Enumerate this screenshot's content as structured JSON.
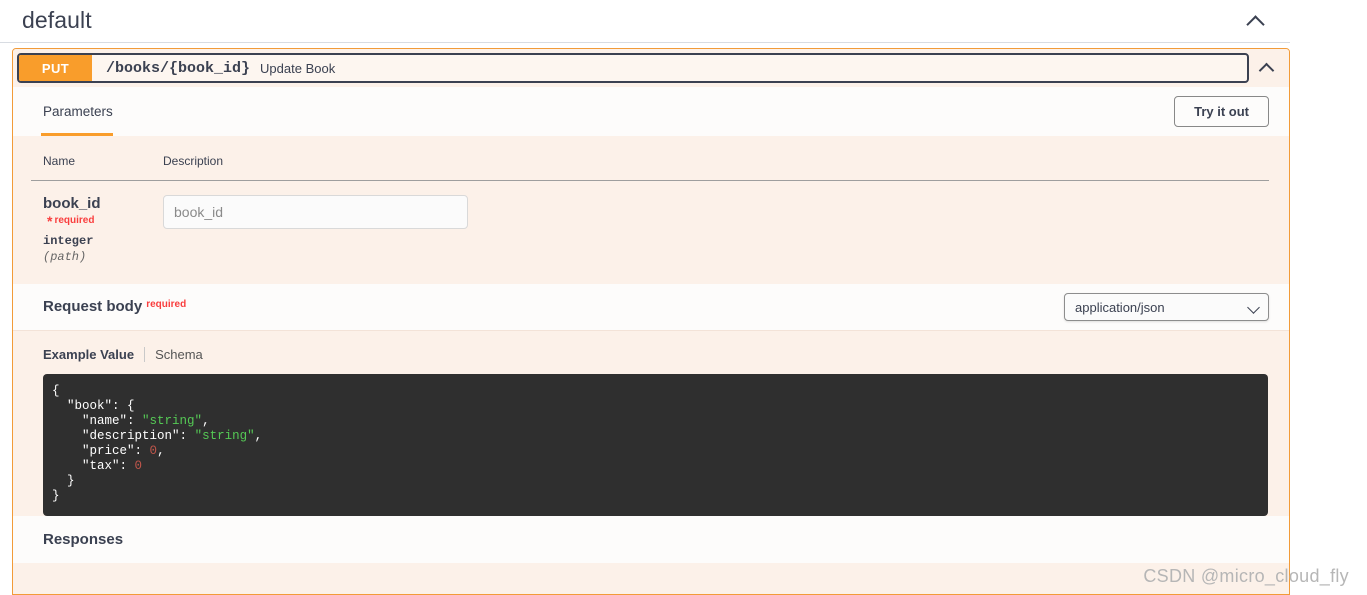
{
  "tag": {
    "title": "default",
    "collapse_icon": "chevron-up-icon"
  },
  "operation": {
    "method": "PUT",
    "path": "/books/{book_id}",
    "summary": "Update Book",
    "collapse_icon": "chevron-up-icon"
  },
  "tabs": [
    {
      "label": "Parameters",
      "active": true
    }
  ],
  "try_it_out": {
    "label": "Try it out"
  },
  "parameters": {
    "headers": {
      "name": "Name",
      "description": "Description"
    },
    "rows": [
      {
        "name": "book_id",
        "required_star": "*",
        "required_label": "required",
        "type": "integer",
        "in": "(path)",
        "input_placeholder": "book_id",
        "input_value": ""
      }
    ]
  },
  "request_body": {
    "title": "Request body",
    "required_label": "required",
    "content_type": "application/json",
    "content_type_caret": "chevron-down-icon"
  },
  "example": {
    "tabs": [
      {
        "label": "Example Value",
        "active": true
      },
      {
        "label": "Schema",
        "active": false
      }
    ],
    "code_lines": [
      [
        {
          "t": "punct",
          "v": "{"
        }
      ],
      [
        {
          "t": "plain",
          "v": "  "
        },
        {
          "t": "key",
          "v": "\"book\""
        },
        {
          "t": "punct",
          "v": ": {"
        }
      ],
      [
        {
          "t": "plain",
          "v": "    "
        },
        {
          "t": "key",
          "v": "\"name\""
        },
        {
          "t": "punct",
          "v": ": "
        },
        {
          "t": "str",
          "v": "\"string\""
        },
        {
          "t": "punct",
          "v": ","
        }
      ],
      [
        {
          "t": "plain",
          "v": "    "
        },
        {
          "t": "key",
          "v": "\"description\""
        },
        {
          "t": "punct",
          "v": ": "
        },
        {
          "t": "str",
          "v": "\"string\""
        },
        {
          "t": "punct",
          "v": ","
        }
      ],
      [
        {
          "t": "plain",
          "v": "    "
        },
        {
          "t": "key",
          "v": "\"price\""
        },
        {
          "t": "punct",
          "v": ": "
        },
        {
          "t": "num",
          "v": "0"
        },
        {
          "t": "punct",
          "v": ","
        }
      ],
      [
        {
          "t": "plain",
          "v": "    "
        },
        {
          "t": "key",
          "v": "\"tax\""
        },
        {
          "t": "punct",
          "v": ": "
        },
        {
          "t": "num",
          "v": "0"
        }
      ],
      [
        {
          "t": "plain",
          "v": "  "
        },
        {
          "t": "punct",
          "v": "}"
        }
      ],
      [
        {
          "t": "punct",
          "v": "}"
        }
      ]
    ]
  },
  "responses": {
    "title": "Responses"
  },
  "watermark": {
    "text": "CSDN @micro_cloud_fly"
  },
  "colors": {
    "method_put": "#f99d2b",
    "accent_orange": "#f29b38",
    "required_red": "#f93e3e",
    "text_primary": "#3b4151",
    "block_bg": "#fcf1e9",
    "row_bg": "#fdfcfb",
    "code_bg": "#2f2f2f",
    "code_string": "#55c955",
    "code_number": "#c0564b"
  }
}
